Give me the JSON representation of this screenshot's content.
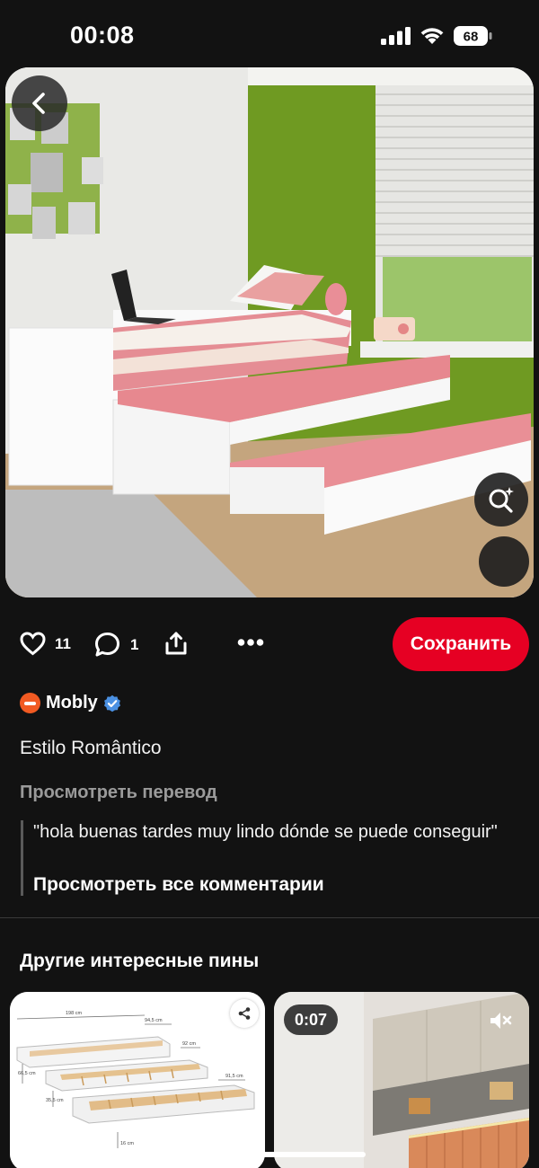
{
  "status_bar": {
    "time": "00:08",
    "battery": "68"
  },
  "pin": {
    "likes": "11",
    "comments": "1",
    "save_label": "Сохранить",
    "author": "Mobly",
    "title": "Estilo Romântico",
    "translate_label": "Просмотреть перевод",
    "top_comment": "\"hola buenas tardes muy lindo dónde se puede conseguir\"",
    "view_all_comments": "Просмотреть все комментарии"
  },
  "more_pins": {
    "title": "Другие интересные пины",
    "items": [
      {
        "kind": "image",
        "dims": [
          "198 cm",
          "94,5 cm",
          "92 cm",
          "91,5 cm",
          "66,5 cm",
          "35,5 cm",
          "16 cm"
        ]
      },
      {
        "kind": "video",
        "duration": "0:07"
      }
    ]
  },
  "colors": {
    "accent": "#e60023",
    "background": "#121212",
    "verified": "#4a90e2",
    "author_logo": "#f15a22"
  },
  "icons": [
    "chevron-left-icon",
    "visual-search-icon",
    "heart-icon",
    "comment-icon",
    "share-icon",
    "more-icon",
    "verified-icon",
    "mute-icon"
  ]
}
